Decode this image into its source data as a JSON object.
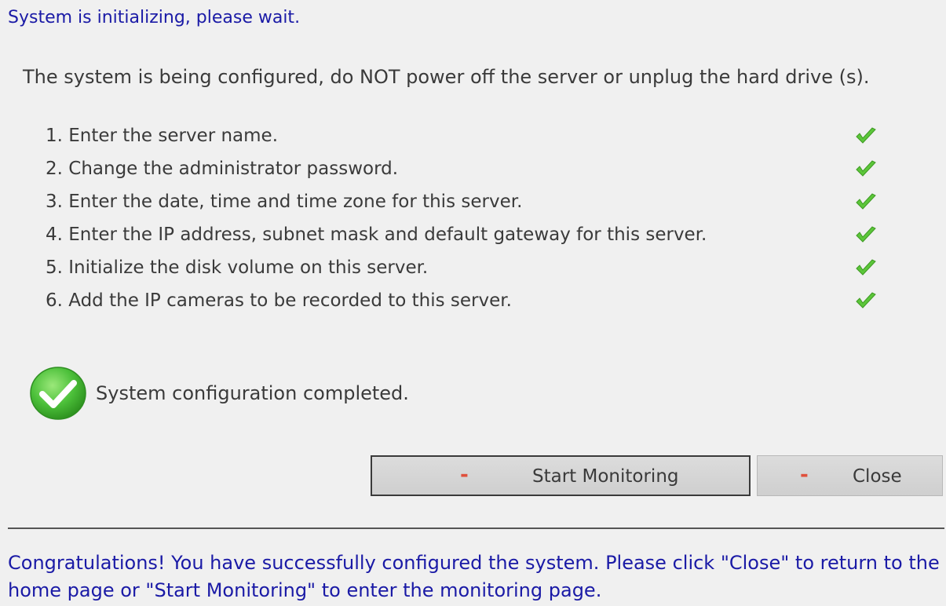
{
  "header": {
    "title": "System is initializing, please wait."
  },
  "warning_text": "The system is being configured, do NOT power off the server or unplug the hard drive (s).",
  "steps": [
    {
      "label": "1. Enter the server name.",
      "icon": "check-icon",
      "status": "done"
    },
    {
      "label": "2. Change the administrator password.",
      "icon": "check-icon",
      "status": "done"
    },
    {
      "label": "3. Enter the date, time and time zone for this server.",
      "icon": "check-icon",
      "status": "done"
    },
    {
      "label": "4. Enter the IP address, subnet mask and default gateway for this server.",
      "icon": "check-icon",
      "status": "done"
    },
    {
      "label": "5. Initialize the disk volume on this server.",
      "icon": "check-icon",
      "status": "done"
    },
    {
      "label": "6. Add the IP cameras to be recorded to this server.",
      "icon": "check-icon",
      "status": "done"
    }
  ],
  "status": {
    "icon": "success-circle-icon",
    "text": "System configuration completed."
  },
  "buttons": {
    "start_monitoring": {
      "mark": "-",
      "label": "Start Monitoring"
    },
    "close": {
      "mark": "-",
      "label": "Close"
    }
  },
  "footer": {
    "message": "Congratulations! You have successfully configured the system. Please click \"Close\" to return to the home page or \"Start Monitoring\" to enter the monitoring page."
  },
  "colors": {
    "background": "#f0f0f0",
    "heading_blue": "#1a1aa6",
    "check_green": "#4cb82c",
    "button_mark_red": "#e0503c"
  }
}
